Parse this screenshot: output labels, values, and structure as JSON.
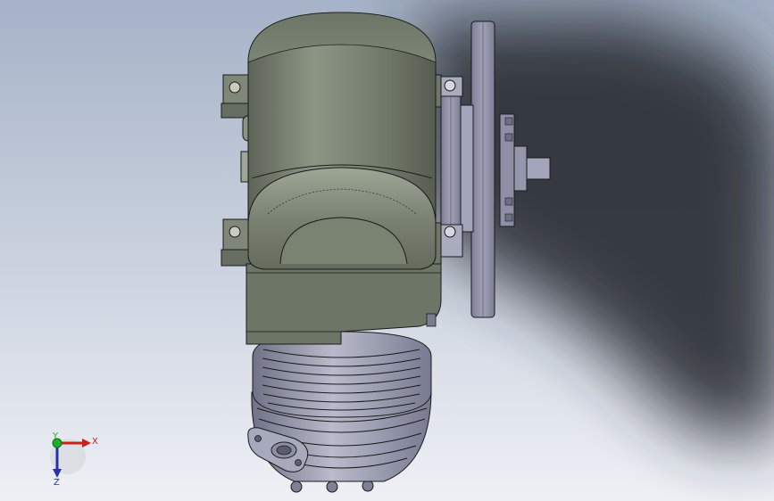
{
  "viewport": {
    "background_top": "#a5b2c7",
    "background_bottom": "#eef0f5",
    "shadow_color": "#2a2d33"
  },
  "model": {
    "motor_color": "#727a6c",
    "motor_highlight": "#97a08f",
    "motor_dark": "#4e5549",
    "flange_color": "#9596ad",
    "flange_dark": "#6e6f86",
    "gearbox_color": "#a6a8bc",
    "gearbox_dark": "#7d7f94",
    "edge_color": "#1a1a1a"
  },
  "triad": {
    "x_label": "X",
    "y_label": "Y",
    "z_label": "Z",
    "x_color": "#c8201c",
    "y_color": "#1fae2b",
    "z_color": "#2531b0"
  }
}
